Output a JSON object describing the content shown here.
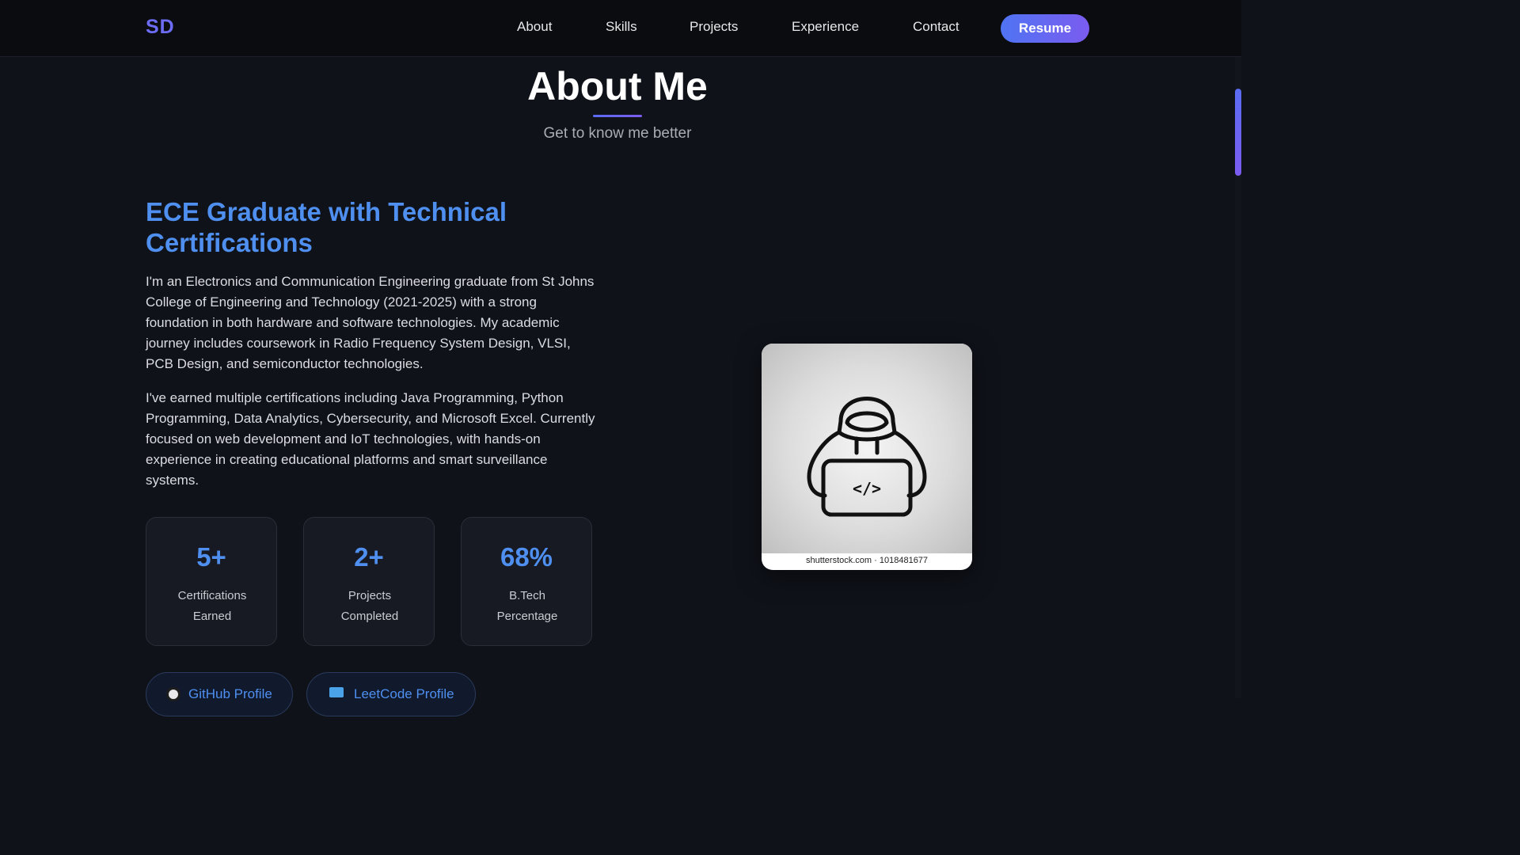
{
  "nav": {
    "logo": "SD",
    "links": [
      "About",
      "Skills",
      "Projects",
      "Experience",
      "Contact"
    ],
    "resume_label": "Resume"
  },
  "section": {
    "title": "About Me",
    "subtitle": "Get to know me better"
  },
  "about": {
    "heading": "ECE Graduate with Technical Certifications",
    "paragraph1": "I'm an Electronics and Communication Engineering graduate from St Johns College of Engineering and Technology (2021-2025) with a strong foundation in both hardware and software technologies. My academic journey includes coursework in Radio Frequency System Design, VLSI, PCB Design, and semiconductor technologies.",
    "paragraph2": "I've earned multiple certifications including Java Programming, Python Programming, Data Analytics, Cybersecurity, and Microsoft Excel. Currently focused on web development and IoT technologies, with hands-on experience in creating educational platforms and smart surveillance systems."
  },
  "stats": [
    {
      "value": "5+",
      "label": "Certifications Earned"
    },
    {
      "value": "2+",
      "label": "Projects Completed"
    },
    {
      "value": "68%",
      "label": "B.Tech Percentage"
    }
  ],
  "profiles": {
    "github_label": "GitHub Profile",
    "github_icon": "github-icon",
    "leetcode_label": "LeetCode Profile",
    "leetcode_icon": "laptop-icon"
  },
  "image": {
    "caption": "shutterstock.com · 1018481677",
    "code_glyph": "</>"
  },
  "colors": {
    "accent": "#4e8ff0",
    "brand_gradient_start": "#4f74f3",
    "brand_gradient_end": "#7b5cf0",
    "background": "#0f1219"
  }
}
